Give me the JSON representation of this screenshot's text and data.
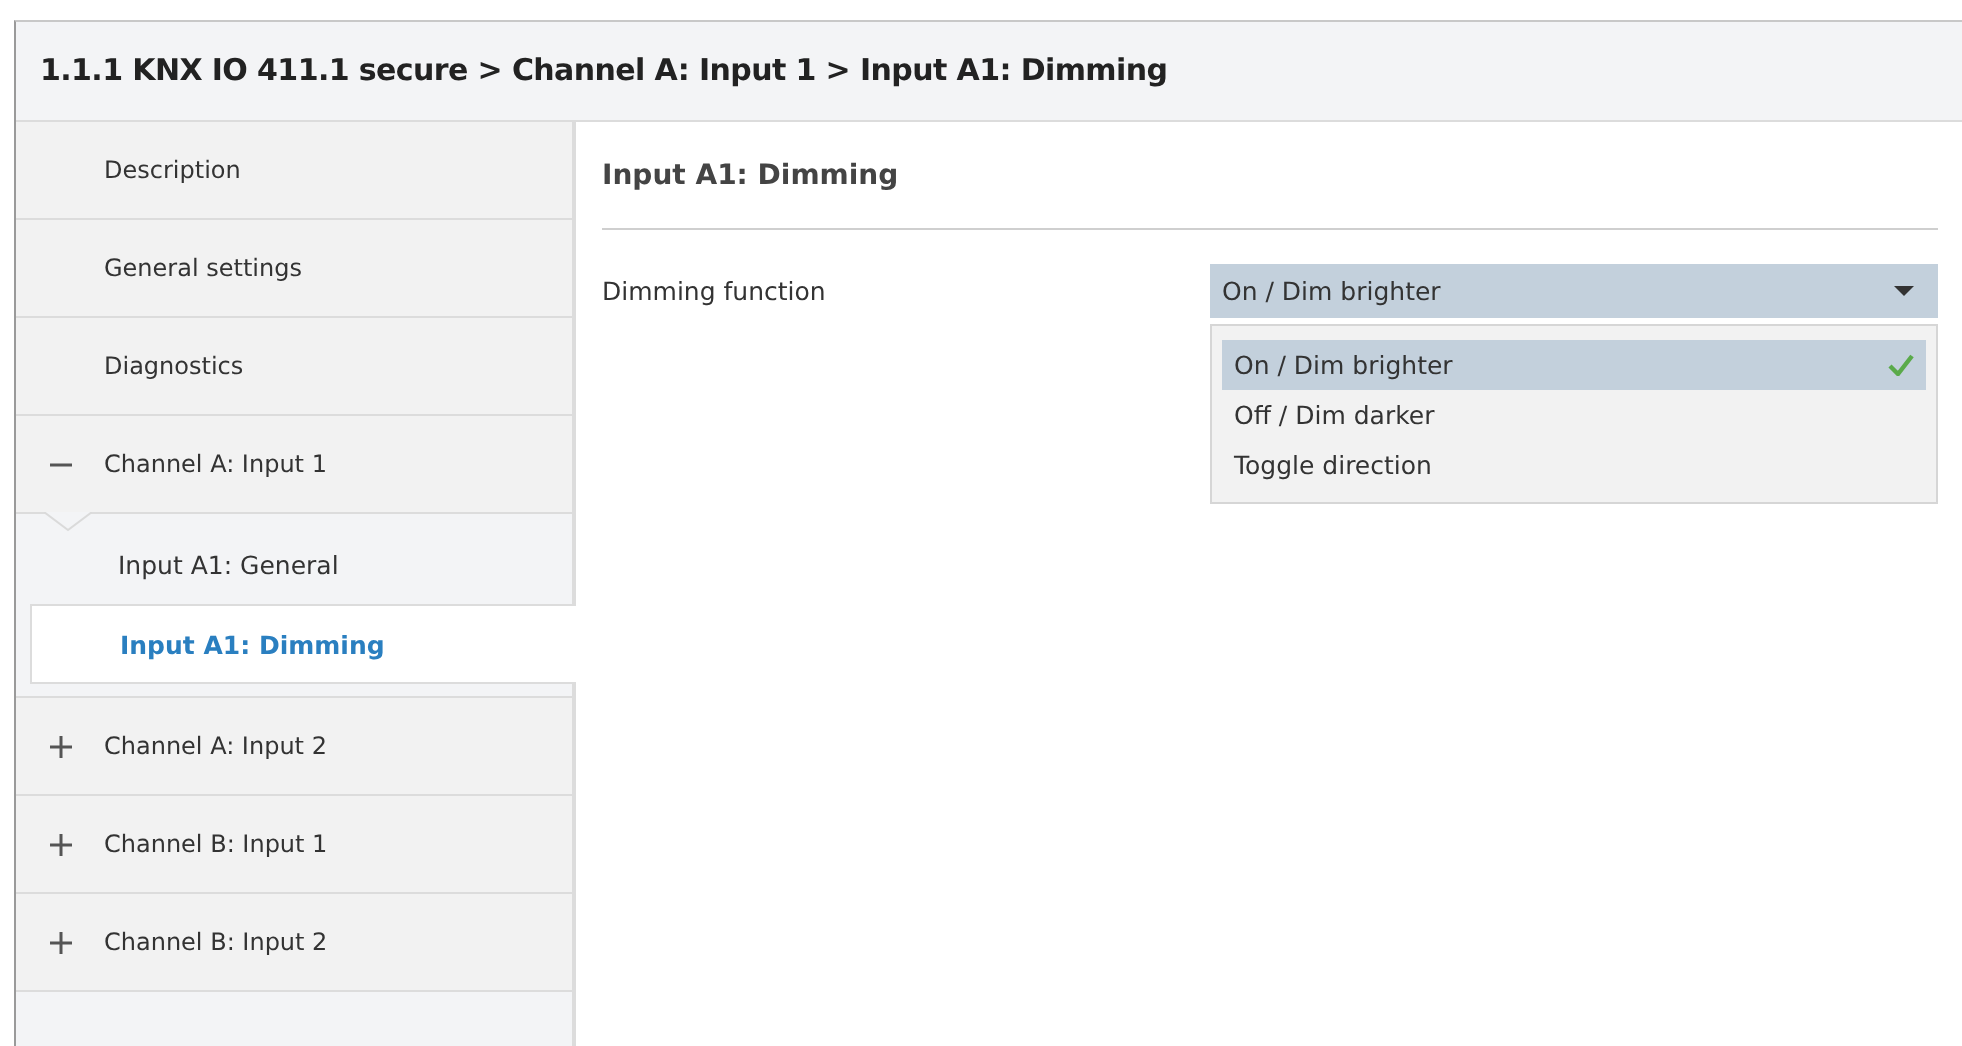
{
  "window": {
    "title": "1.1.1 KNX IO 411.1 secure > Channel A: Input 1 > Input A1: Dimming"
  },
  "sidebar": {
    "items": [
      {
        "kind": "page",
        "label": "Description",
        "selected": false
      },
      {
        "kind": "page",
        "label": "General settings",
        "selected": false
      },
      {
        "kind": "page",
        "label": "Diagnostics",
        "selected": false
      },
      {
        "kind": "group",
        "label": "Channel A: Input 1",
        "expanded": true,
        "selected": false,
        "children": [
          {
            "label": "Input A1: General",
            "selected": false
          },
          {
            "label": "Input A1: Dimming",
            "selected": true
          }
        ]
      },
      {
        "kind": "group",
        "label": "Channel A: Input 2",
        "expanded": false,
        "selected": false
      },
      {
        "kind": "group",
        "label": "Channel B: Input 1",
        "expanded": false,
        "selected": false
      },
      {
        "kind": "group",
        "label": "Channel B: Input 2",
        "expanded": false,
        "selected": false
      }
    ]
  },
  "content": {
    "heading": "Input A1: Dimming",
    "parameter": {
      "label": "Dimming function",
      "value": "On / Dim brighter",
      "options": [
        {
          "label": "On / Dim brighter",
          "selected": true
        },
        {
          "label": "Off / Dim darker",
          "selected": false
        },
        {
          "label": "Toggle direction",
          "selected": false
        }
      ]
    }
  }
}
